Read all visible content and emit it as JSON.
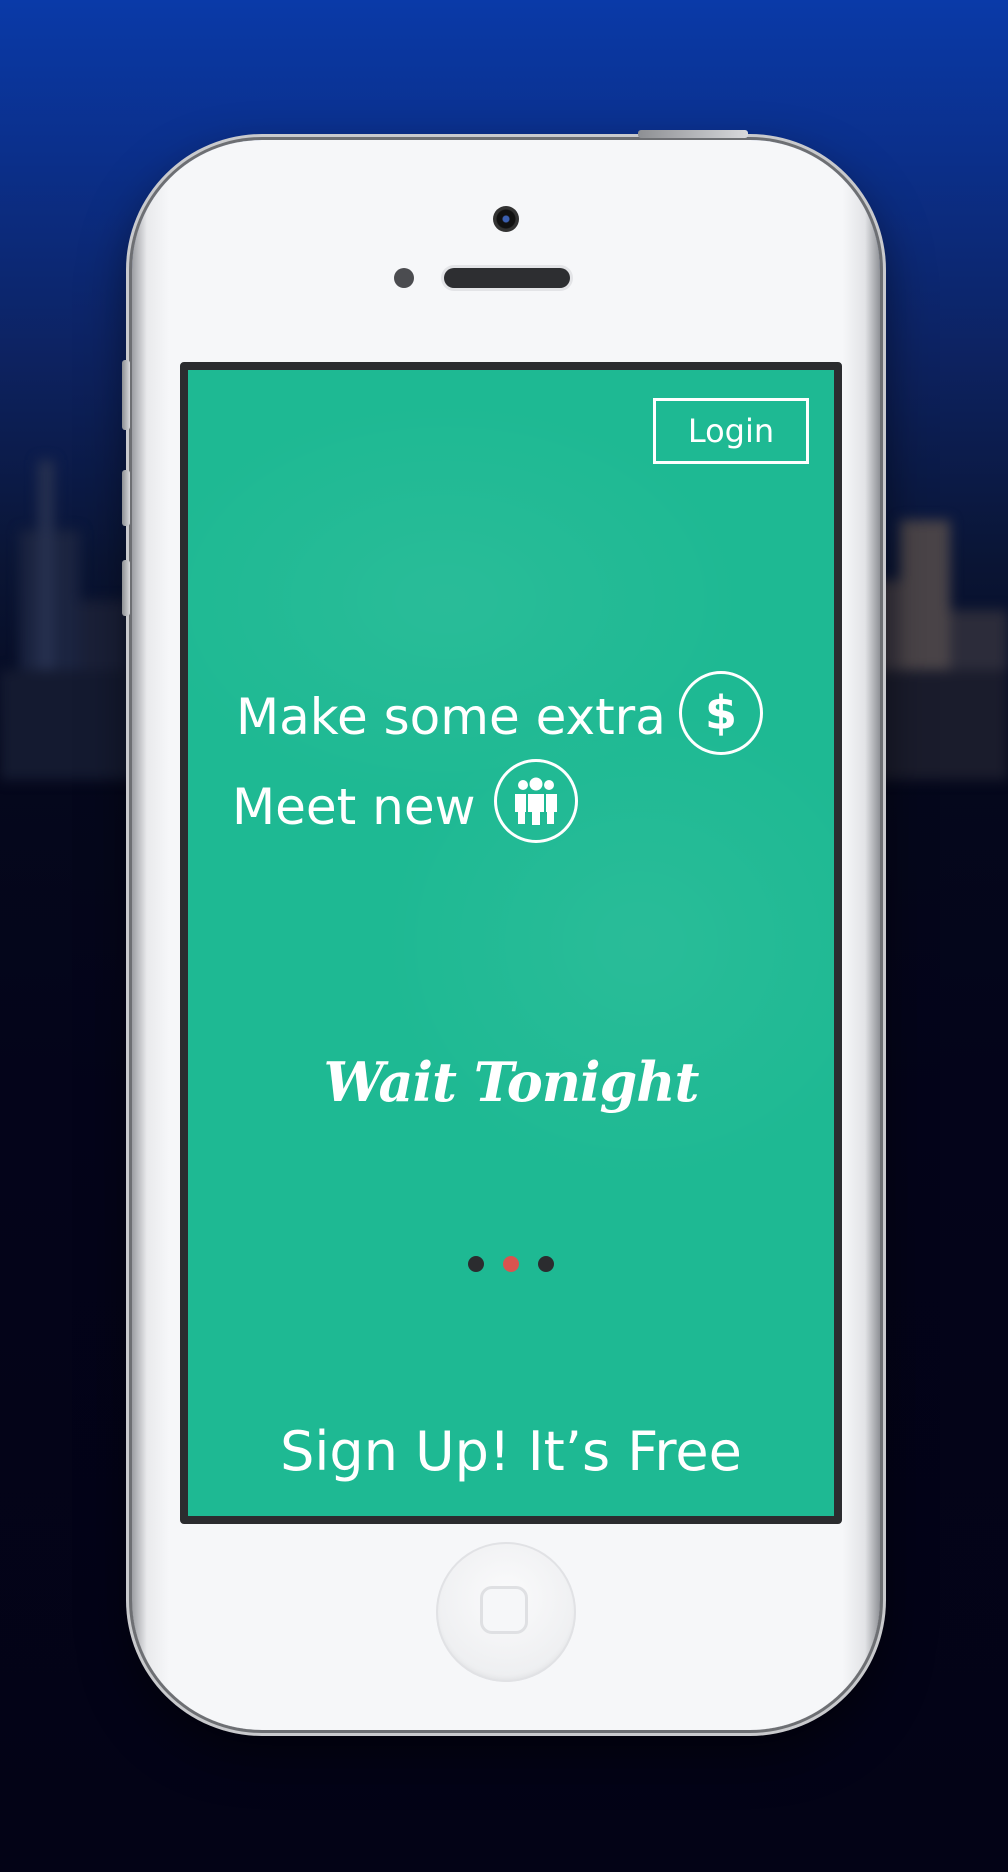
{
  "screen": {
    "login_label": "Login",
    "tagline_1": "Make some extra",
    "tagline_2": "Meet new",
    "tagline_1_icon": "dollar-icon",
    "tagline_2_icon": "people-icon",
    "dollar_glyph": "$",
    "brand": "Wait Tonight",
    "signup_label": "Sign Up! It’s Free",
    "pagination": {
      "total": 3,
      "active_index": 1
    }
  },
  "colors": {
    "screen_green": "#1eb993",
    "text": "#ffffff",
    "dot_inactive": "#2b2c2f",
    "dot_active": "#d9534f",
    "phone_body": "#f6f7f9",
    "sky_top": "#0a3aa8",
    "sky_bottom": "#030316"
  }
}
